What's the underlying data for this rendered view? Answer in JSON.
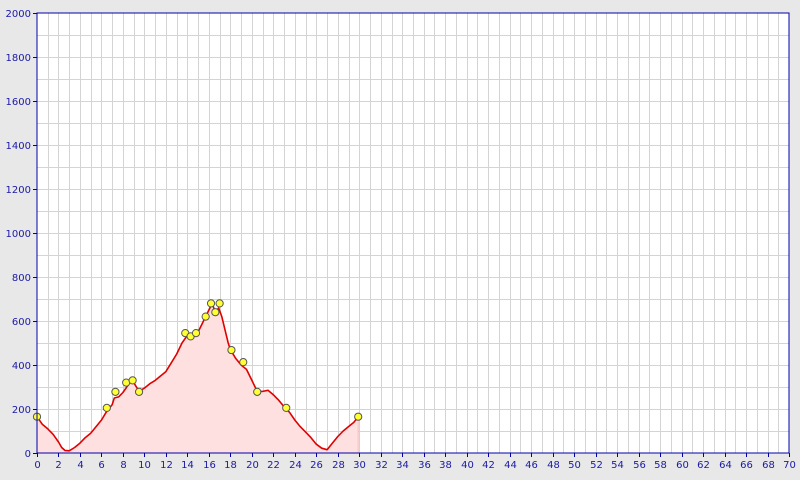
{
  "chart_data": {
    "type": "area",
    "title": "",
    "xlabel": "",
    "ylabel": "",
    "xlim": [
      0,
      70
    ],
    "ylim": [
      0,
      2000
    ],
    "x_ticks": [
      0,
      2,
      4,
      6,
      8,
      10,
      12,
      14,
      16,
      18,
      20,
      22,
      24,
      26,
      28,
      30,
      32,
      34,
      36,
      38,
      40,
      42,
      44,
      46,
      48,
      50,
      52,
      54,
      56,
      58,
      60,
      62,
      64,
      66,
      68,
      70
    ],
    "y_ticks": [
      0,
      200,
      400,
      600,
      800,
      1000,
      1200,
      1400,
      1600,
      1800,
      2000
    ],
    "grid": true,
    "legend": "none",
    "colors": {
      "line": "#e00000",
      "fill": "#ffe0e0",
      "marker_fill": "#ffff33",
      "marker_stroke": "#555555",
      "axis": "#0000aa",
      "grid": "#d4d4d4",
      "plot_bg": "#ffffff",
      "frame_bg": "#e8e8e8"
    },
    "series": [
      {
        "values": [
          [
            0,
            165
          ],
          [
            0.5,
            130
          ],
          [
            1,
            110
          ],
          [
            1.5,
            85
          ],
          [
            2,
            50
          ],
          [
            2.3,
            25
          ],
          [
            2.6,
            12
          ],
          [
            3,
            10
          ],
          [
            3.5,
            25
          ],
          [
            4,
            45
          ],
          [
            4.5,
            70
          ],
          [
            5,
            90
          ],
          [
            5.5,
            120
          ],
          [
            6,
            150
          ],
          [
            6.5,
            190
          ],
          [
            7,
            220
          ],
          [
            7.2,
            250
          ],
          [
            7.6,
            255
          ],
          [
            8,
            275
          ],
          [
            8.5,
            310
          ],
          [
            8.7,
            340
          ],
          [
            9,
            320
          ],
          [
            9.5,
            280
          ],
          [
            10,
            295
          ],
          [
            10.5,
            315
          ],
          [
            11,
            330
          ],
          [
            11.5,
            350
          ],
          [
            12,
            370
          ],
          [
            12.5,
            410
          ],
          [
            13,
            450
          ],
          [
            13.5,
            500
          ],
          [
            14,
            535
          ],
          [
            14.5,
            525
          ],
          [
            15,
            550
          ],
          [
            15.5,
            600
          ],
          [
            16,
            650
          ],
          [
            16.3,
            680
          ],
          [
            16.6,
            640
          ],
          [
            16.9,
            660
          ],
          [
            17.2,
            620
          ],
          [
            17.5,
            560
          ],
          [
            17.8,
            500
          ],
          [
            18,
            470
          ],
          [
            18.5,
            430
          ],
          [
            19,
            400
          ],
          [
            19.5,
            380
          ],
          [
            20,
            330
          ],
          [
            20.5,
            280
          ],
          [
            21,
            280
          ],
          [
            21.5,
            285
          ],
          [
            22,
            265
          ],
          [
            22.5,
            240
          ],
          [
            23,
            210
          ],
          [
            23.5,
            185
          ],
          [
            24,
            150
          ],
          [
            24.5,
            120
          ],
          [
            25,
            95
          ],
          [
            25.5,
            70
          ],
          [
            26,
            40
          ],
          [
            26.5,
            22
          ],
          [
            27,
            15
          ],
          [
            27.5,
            45
          ],
          [
            28,
            75
          ],
          [
            28.5,
            100
          ],
          [
            29,
            120
          ],
          [
            29.5,
            140
          ],
          [
            29.9,
            165
          ]
        ],
        "markers": [
          [
            0,
            165
          ],
          [
            6.5,
            205
          ],
          [
            7.3,
            278
          ],
          [
            8.3,
            320
          ],
          [
            8.9,
            330
          ],
          [
            9.5,
            278
          ],
          [
            13.8,
            545
          ],
          [
            14.3,
            530
          ],
          [
            14.8,
            545
          ],
          [
            15.7,
            620
          ],
          [
            16.2,
            680
          ],
          [
            16.6,
            640
          ],
          [
            17,
            680
          ],
          [
            18.1,
            468
          ],
          [
            19.2,
            413
          ],
          [
            20.5,
            278
          ],
          [
            23.2,
            205
          ],
          [
            29.9,
            165
          ]
        ]
      }
    ]
  }
}
